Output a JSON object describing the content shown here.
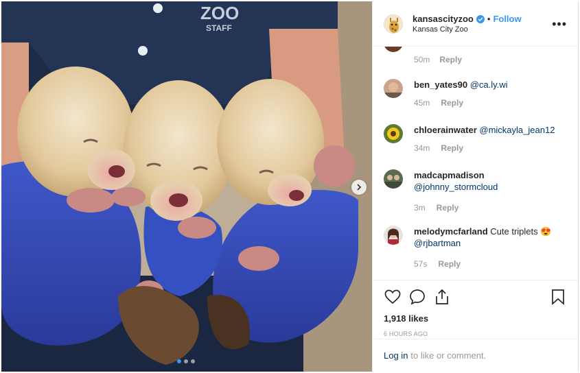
{
  "post": {
    "username": "kansascityzoo",
    "separator": "•",
    "follow_label": "Follow",
    "location": "Kansas City Zoo",
    "more_label": "•••",
    "shirt_logo_line1": "ZOO",
    "shirt_logo_line2": "STAFF",
    "carousel": {
      "dot_count": 3,
      "active_index": 0
    }
  },
  "comments": {
    "first_partial": {
      "time": "50m",
      "reply_label": "Reply"
    },
    "items": [
      {
        "user": "ben_yates90",
        "text": "",
        "mention": "@ca.ly.wi",
        "time": "45m",
        "reply_label": "Reply"
      },
      {
        "user": "chloerainwater",
        "text": "",
        "mention": "@mickayla_jean12",
        "time": "34m",
        "reply_label": "Reply"
      },
      {
        "user": "madcapmadison",
        "text": "",
        "mention": "@johnny_stormcloud",
        "time": "3m",
        "reply_label": "Reply"
      },
      {
        "user": "melodymcfarland",
        "text": "Cute triplets 😍",
        "mention": "@rjbartman",
        "time": "57s",
        "reply_label": "Reply"
      }
    ]
  },
  "engagement": {
    "likes": "1,918 likes",
    "posted": "6 HOURS AGO"
  },
  "login": {
    "link_label": "Log in",
    "rest_text": "to like or comment."
  },
  "colors": {
    "accent": "#3897f0",
    "mention": "#003569",
    "muted": "#999999"
  }
}
